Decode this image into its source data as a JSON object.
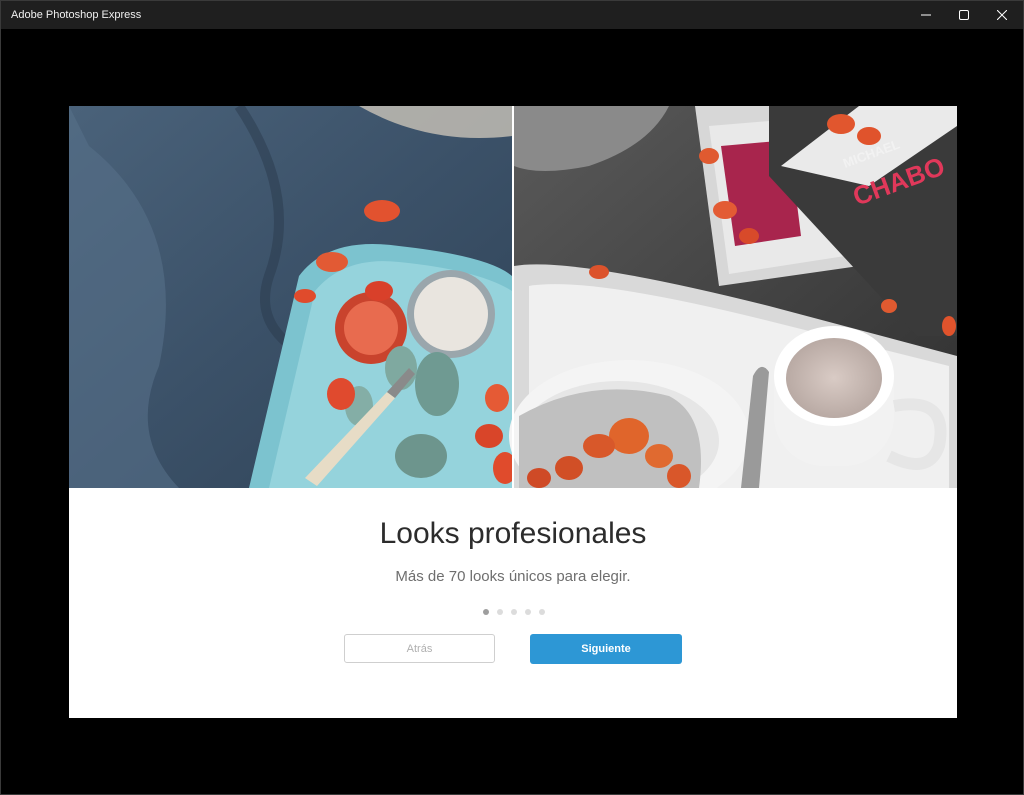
{
  "window": {
    "title": "Adobe Photoshop Express",
    "controls": {
      "minimize_icon": "minimize-icon",
      "maximize_icon": "maximize-icon",
      "close_icon": "close-icon"
    }
  },
  "onboarding": {
    "heading": "Looks profesionales",
    "subheading": "Más de 70 looks únicos para elegir.",
    "page_indicator": {
      "current": 1,
      "total": 5
    },
    "back_label": "Atrás",
    "next_label": "Siguiente"
  },
  "colors": {
    "accent": "#2d97d5",
    "titlebar": "#1f1f1f",
    "background": "#000000"
  }
}
